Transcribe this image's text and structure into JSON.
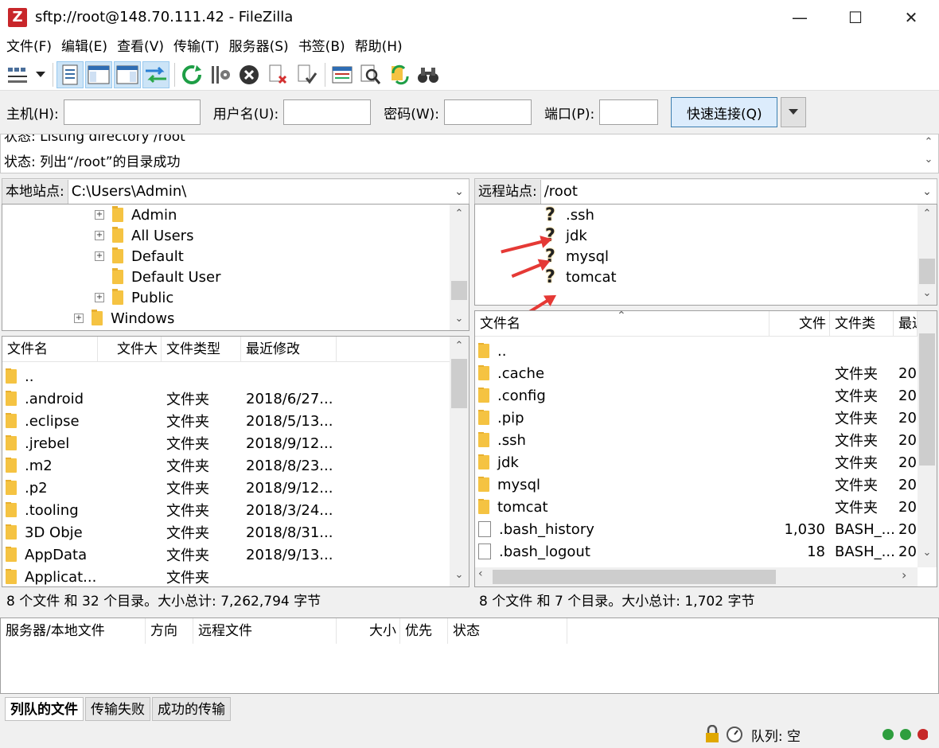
{
  "window": {
    "title": "sftp://root@148.70.111.42 - FileZilla",
    "app_icon": "Z"
  },
  "menu": [
    "文件(F)",
    "编辑(E)",
    "查看(V)",
    "传输(T)",
    "服务器(S)",
    "书签(B)",
    "帮助(H)"
  ],
  "quickconnect": {
    "host_label": "主机(H):",
    "user_label": "用户名(U):",
    "pass_label": "密码(W):",
    "port_label": "端口(P):",
    "host_value": "",
    "user_value": "",
    "pass_value": "",
    "port_value": "",
    "connect_label": "快速连接(Q)"
  },
  "log": {
    "line1": "状态:  Listing directory /root",
    "line2": "状态:  列出“/root”的目录成功"
  },
  "local": {
    "site_label": "本地站点:",
    "path": "C:\\Users\\Admin\\",
    "tree": [
      "Admin",
      "All Users",
      "Default",
      "Default User",
      "Public",
      "Windows"
    ],
    "columns": [
      "文件名",
      "文件大",
      "文件类型",
      "最近修改"
    ],
    "files": [
      {
        "name": "..",
        "size": "",
        "type": "",
        "modified": ""
      },
      {
        "name": ".android",
        "size": "",
        "type": "文件夹",
        "modified": "2018/6/27..."
      },
      {
        "name": ".eclipse",
        "size": "",
        "type": "文件夹",
        "modified": "2018/5/13..."
      },
      {
        "name": ".jrebel",
        "size": "",
        "type": "文件夹",
        "modified": "2018/9/12..."
      },
      {
        "name": ".m2",
        "size": "",
        "type": "文件夹",
        "modified": "2018/8/23..."
      },
      {
        "name": ".p2",
        "size": "",
        "type": "文件夹",
        "modified": "2018/9/12..."
      },
      {
        "name": ".tooling",
        "size": "",
        "type": "文件夹",
        "modified": "2018/3/24..."
      },
      {
        "name": "3D Obje",
        "size": "",
        "type": "文件夹",
        "modified": "2018/8/31..."
      },
      {
        "name": "AppData",
        "size": "",
        "type": "文件夹",
        "modified": "2018/9/13..."
      },
      {
        "name": "Applicat...",
        "size": "",
        "type": "文件夹",
        "modified": ""
      }
    ],
    "status": "8 个文件 和 32 个目录。大小总计: 7,262,794 字节"
  },
  "remote": {
    "site_label": "远程站点:",
    "path": "/root",
    "tree": [
      ".ssh",
      "jdk",
      "mysql",
      "tomcat"
    ],
    "tree_icon": "?",
    "columns": [
      "文件名",
      "文件",
      "文件类",
      "最近"
    ],
    "files": [
      {
        "name": "..",
        "size": "",
        "type": "",
        "modified": ""
      },
      {
        "name": ".cache",
        "size": "",
        "type": "文件夹",
        "modified": "20"
      },
      {
        "name": ".config",
        "size": "",
        "type": "文件夹",
        "modified": "20"
      },
      {
        "name": ".pip",
        "size": "",
        "type": "文件夹",
        "modified": "20"
      },
      {
        "name": ".ssh",
        "size": "",
        "type": "文件夹",
        "modified": "20"
      },
      {
        "name": "jdk",
        "size": "",
        "type": "文件夹",
        "modified": "20"
      },
      {
        "name": "mysql",
        "size": "",
        "type": "文件夹",
        "modified": "20"
      },
      {
        "name": "tomcat",
        "size": "",
        "type": "文件夹",
        "modified": "20"
      },
      {
        "name": ".bash_history",
        "size": "1,030",
        "type": "BASH_...",
        "modified": "20"
      },
      {
        "name": ".bash_logout",
        "size": "18",
        "type": "BASH_...",
        "modified": "20"
      }
    ],
    "status": "8 个文件 和 7 个目录。大小总计: 1,702 字节"
  },
  "queue": {
    "columns": [
      "服务器/本地文件",
      "方向",
      "远程文件",
      "大小",
      "优先",
      "状态"
    ],
    "tabs": [
      "列队的文件",
      "传输失败",
      "成功的传输"
    ],
    "status": "队列: 空"
  },
  "colors": {
    "accent": "#3c7fb1",
    "folder": "#f5c342",
    "annotation": "#e53935"
  }
}
